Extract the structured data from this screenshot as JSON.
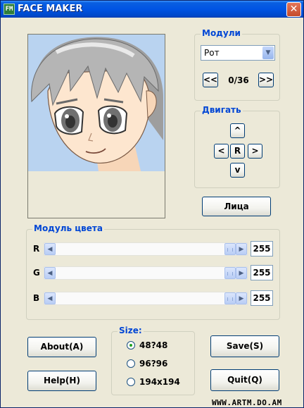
{
  "window": {
    "title": "FACE MAKER",
    "icon_name": "app-icon",
    "icon_text": "FM",
    "close_glyph": "✕"
  },
  "modules": {
    "title": "Модули",
    "selected": "Рот",
    "prev_label": "<<",
    "next_label": ">>",
    "counter": "0/36"
  },
  "move": {
    "title": "Двигать",
    "up": "^",
    "left": "<",
    "reset": "R",
    "right": ">",
    "down": "v"
  },
  "faces_button": "Лица",
  "color_module": {
    "title": "Модуль цвета",
    "channels": [
      {
        "label": "R",
        "value": "255",
        "fraction": 1.0
      },
      {
        "label": "G",
        "value": "255",
        "fraction": 1.0
      },
      {
        "label": "B",
        "value": "255",
        "fraction": 1.0
      }
    ]
  },
  "size": {
    "title": "Size:",
    "options": [
      "48?48",
      "96?96",
      "194x194"
    ],
    "selected_index": 0
  },
  "buttons": {
    "about": "About(A)",
    "help": "Help(H)",
    "save": "Save(S)",
    "quit": "Quit(Q)"
  },
  "watermark": "WWW.ARTM.DO.AM",
  "colors": {
    "title_bar": "#0054e3",
    "group_title": "#0046d5",
    "face_background": "#b9d3f0",
    "hair": "#a9a9a9",
    "skin": "#fde6cf"
  }
}
